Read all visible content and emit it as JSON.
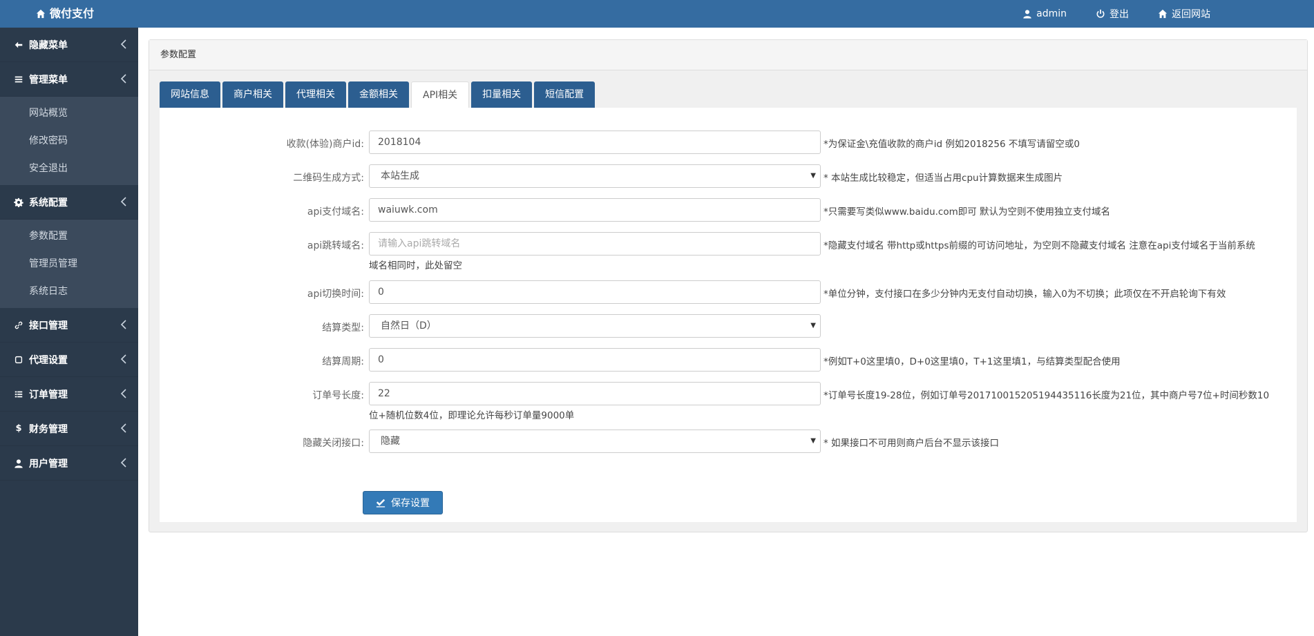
{
  "topbar": {
    "brand": "微付支付",
    "user": "admin",
    "logout": "登出",
    "back_site": "返回网站"
  },
  "sidebar": {
    "groups": [
      {
        "label": "隐藏菜单",
        "icon": "arrow-left-icon"
      },
      {
        "label": "管理菜单",
        "icon": "list-icon",
        "items": [
          "网站概览",
          "修改密码",
          "安全退出"
        ]
      },
      {
        "label": "系统配置",
        "icon": "gear-icon",
        "items": [
          "参数配置",
          "管理员管理",
          "系统日志"
        ]
      },
      {
        "label": "接口管理",
        "icon": "link-icon"
      },
      {
        "label": "代理设置",
        "icon": "square-icon"
      },
      {
        "label": "订单管理",
        "icon": "list-icon"
      },
      {
        "label": "财务管理",
        "icon": "dollar-icon"
      },
      {
        "label": "用户管理",
        "icon": "user-icon"
      }
    ]
  },
  "panel": {
    "title": "参数配置",
    "tabs": [
      "网站信息",
      "商户相关",
      "代理相关",
      "金额相关",
      "API相关",
      "扣量相关",
      "短信配置"
    ],
    "active_tab": "API相关"
  },
  "form": {
    "merchant_id": {
      "label": "收款(体验)商户id:",
      "value": "2018104",
      "hint": "*为保证金\\充值收款的商户id 例如2018256 不填写请留空或0"
    },
    "qrcode_mode": {
      "label": "二维码生成方式:",
      "value": "本站生成",
      "hint": "* 本站生成比较稳定，但适当占用cpu计算数据来生成图片"
    },
    "api_domain": {
      "label": "api支付域名:",
      "value": "waiuwk.com",
      "hint": "*只需要写类似www.baidu.com即可 默认为空则不使用独立支付域名"
    },
    "api_jump_domain": {
      "label": "api跳转域名:",
      "placeholder": "请输入api跳转域名",
      "hint": "*隐藏支付域名 带http或https前缀的可访问地址，为空则不隐藏支付域名 注意在api支付域名于当前系统",
      "hint2": "域名相同时，此处留空"
    },
    "api_switch_time": {
      "label": "api切换时间:",
      "value": "0",
      "hint": "*单位分钟，支付接口在多少分钟内无支付自动切换，输入0为不切换；此项仅在不开启轮询下有效"
    },
    "settle_type": {
      "label": "结算类型:",
      "value": "自然日（D）"
    },
    "settle_period": {
      "label": "结算周期:",
      "value": "0",
      "hint": "*例如T+0这里填0，D+0这里填0，T+1这里填1，与结算类型配合使用"
    },
    "order_length": {
      "label": "订单号长度:",
      "value": "22",
      "hint": "*订单号长度19-28位，例如订单号20171001520519443511​6长度为21位，其中商户号7位+时间秒数10",
      "hint2": "位+随机位数4位，即理论允许每秒订单量9000单"
    },
    "hide_closed": {
      "label": "隐藏关闭接口:",
      "value": "隐藏",
      "hint": "* 如果接口不可用则商户后台不显示该接口"
    },
    "save_label": "保存设置"
  }
}
